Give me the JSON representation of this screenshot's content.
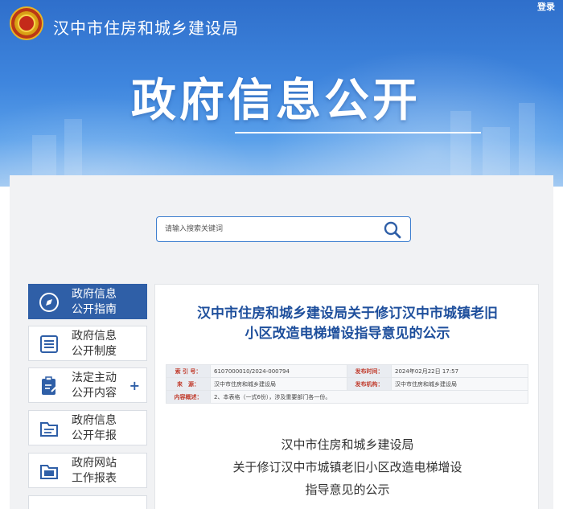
{
  "header": {
    "site_title": "汉中市住房和城乡建设局",
    "login_label": "登录",
    "banner_title": "政府信息公开"
  },
  "search": {
    "placeholder": "请输入搜索关键词"
  },
  "sidebar": {
    "items": [
      {
        "label": "政府信息\n公开指南",
        "icon": "compass-icon",
        "active": true
      },
      {
        "label": "政府信息\n公开制度",
        "icon": "document-list-icon",
        "active": false
      },
      {
        "label": "法定主动\n公开内容",
        "icon": "clipboard-edit-icon",
        "active": false,
        "expand": "+"
      },
      {
        "label": "政府信息\n公开年报",
        "icon": "folder-icon",
        "active": false
      },
      {
        "label": "政府网站\n工作报表",
        "icon": "folder-report-icon",
        "active": false
      }
    ]
  },
  "article": {
    "title_line1": "汉中市住房和城乡建设局关于修订汉中市城镇老旧",
    "title_line2": "小区改造电梯增设指导意见的公示",
    "meta": {
      "index_label": "索 引 号：",
      "index_value": "6107000010/2024-000794",
      "date_label": "发布时间：",
      "date_value": "2024年02月22日 17:57",
      "source_label": "来　源：",
      "source_value": "汉中市住房和城乡建设局",
      "org_label": "发布机构：",
      "org_value": "汉中市住房和城乡建设局",
      "summary_label": "内容概述：",
      "summary_value": "2、本表格（一式6份），涉及重要部门各一份。"
    },
    "body_line1": "汉中市住房和城乡建设局",
    "body_line2": "关于修订汉中市城镇老旧小区改造电梯增设",
    "body_line3": "指导意见的公示"
  },
  "colors": {
    "banner_blue": "#3f86de",
    "active_nav": "#2f5fa7",
    "title_blue": "#1e4f9c",
    "meta_label_red": "#c03a2b"
  }
}
